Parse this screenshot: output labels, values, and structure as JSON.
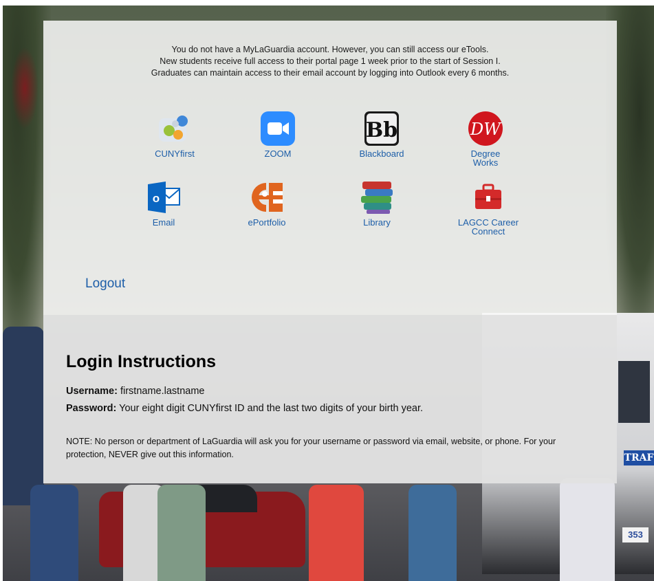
{
  "intro": {
    "line1": "You do not have a MyLaGuardia account. However, you can still access our eTools.",
    "line2": "New students receive full access to their portal page 1 week prior to the start of Session I.",
    "line3": "Graduates can maintain access to their email account by logging into Outlook every 6 months."
  },
  "tools": {
    "cunyfirst": "CUNYfirst",
    "zoom": "ZOOM",
    "blackboard": "Blackboard",
    "blackboard_icon_text": "Bb",
    "degreeworks_line1": "Degree",
    "degreeworks_line2": "Works",
    "degreeworks_icon_text": "DW",
    "email": "Email",
    "email_icon_text": "o",
    "eportfolio": "ePortfolio",
    "library": "Library",
    "career_line1": "LAGCC Career",
    "career_line2": "Connect"
  },
  "logout": "Logout",
  "instructions": {
    "heading": "Login Instructions",
    "username_label": "Username:",
    "username_value": " firstname.lastname",
    "password_label": "Password:",
    "password_value": " Your eight digit CUNYfirst ID and the last two digits of your birth year.",
    "note": "NOTE: No person or department of LaGuardia will ask you for your username or password via email, website, or phone. For your protection, NEVER give out this information."
  },
  "background": {
    "truck_stripe_text": "TRAF",
    "plate_text": "353"
  },
  "colors": {
    "link": "#1d5ea8",
    "zoom": "#2d8cff",
    "degreeworks": "#d0161e",
    "outlook": "#0a66c2",
    "eportfolio": "#e0651f",
    "career": "#d42a2a"
  }
}
